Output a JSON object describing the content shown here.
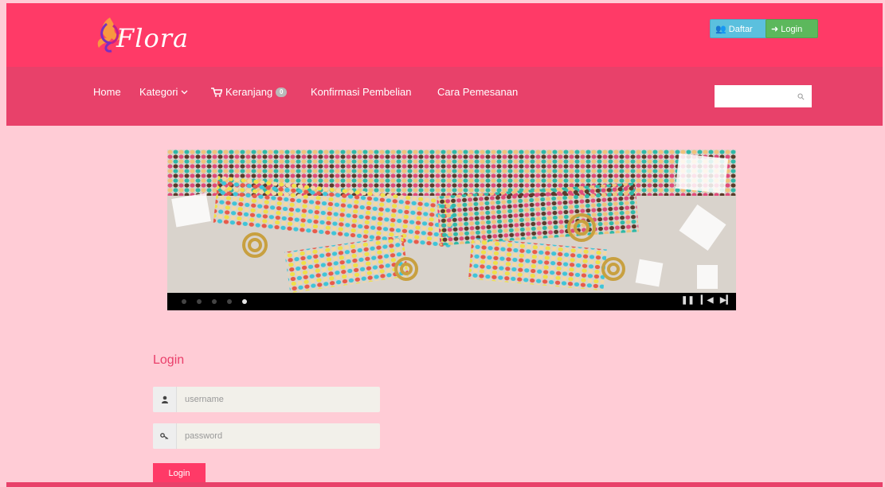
{
  "brand": {
    "name": "Flora",
    "logo_icon": "flower-petal-icon"
  },
  "header": {
    "daftar_label": "Daftar",
    "daftar_icon": "users-icon",
    "login_label": "Login",
    "login_icon": "sign-in-icon"
  },
  "nav": {
    "home": "Home",
    "kategori": "Kategori",
    "keranjang": "Keranjang",
    "cart_count": "0",
    "konfirmasi": "Konfirmasi Pembelian",
    "cara": "Cara Pemesanan",
    "search_placeholder": ""
  },
  "slider": {
    "dot_count": 5,
    "active_index": 4,
    "controls": [
      "pause",
      "previous",
      "next"
    ]
  },
  "login": {
    "title": "Login",
    "username_placeholder": "username",
    "password_placeholder": "password",
    "submit_label": "Login"
  },
  "colors": {
    "topbar": "#ff3a67",
    "navbar": "#e8416a",
    "page_bg": "#ffccd6",
    "daftar_button": "#5bc0de",
    "login_button": "#5cb85c"
  }
}
